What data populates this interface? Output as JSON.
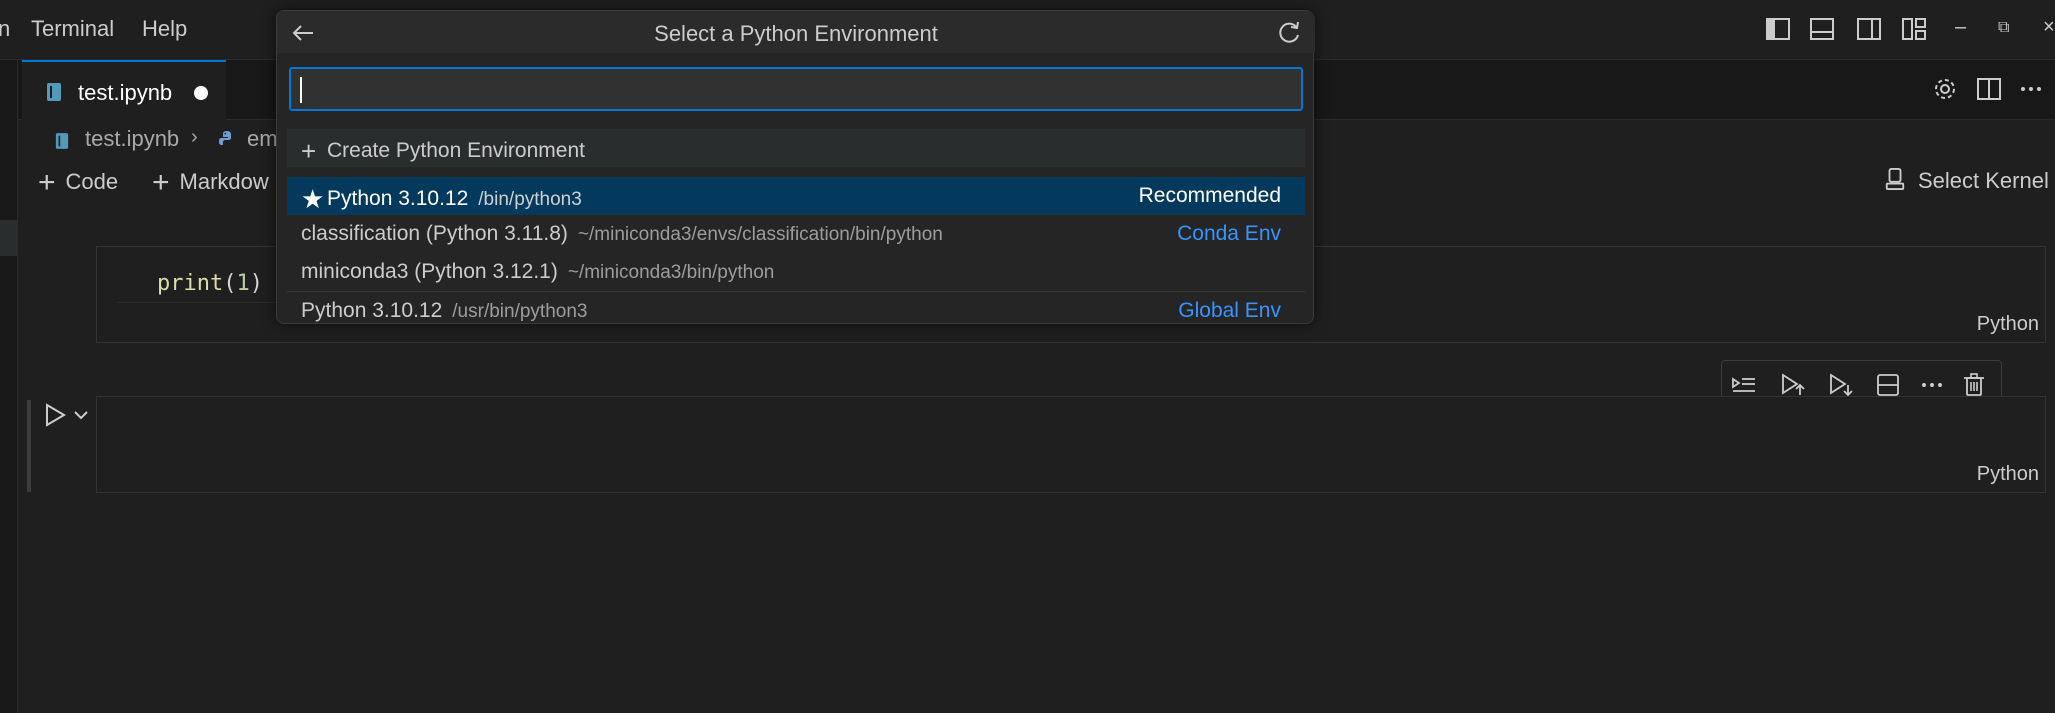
{
  "menu": {
    "partial_item": "n",
    "items": [
      "Terminal",
      "Help"
    ]
  },
  "editor": {
    "tab_label": "test.ipynb",
    "breadcrumb": [
      "test.ipynb",
      "em"
    ],
    "toolbar": {
      "code_label": "Code",
      "markdown_label": "Markdow",
      "select_kernel_label": "Select Kernel"
    },
    "cells": [
      {
        "code_fn": "print",
        "code_open": "(",
        "code_arg": "1",
        "code_close": ")",
        "language": "Python"
      },
      {
        "language": "Python"
      }
    ]
  },
  "quick_pick": {
    "title": "Select a Python Environment",
    "input_value": "",
    "items": [
      {
        "label": "Create Python Environment",
        "description": "",
        "detail": "",
        "icon": "plus-icon"
      },
      {
        "label": "Python 3.10.12",
        "description": "/bin/python3",
        "detail": "Recommended",
        "icon": "star-icon"
      },
      {
        "label": "classification (Python 3.11.8)",
        "description": "~/miniconda3/envs/classification/bin/python",
        "detail": "Conda Env"
      },
      {
        "label": "miniconda3 (Python 3.12.1)",
        "description": "~/miniconda3/bin/python",
        "detail": ""
      },
      {
        "label": "Python 3.10.12",
        "description": "/usr/bin/python3",
        "detail": "Global Env"
      }
    ]
  },
  "colors": {
    "accent": "#0078d4",
    "selection": "#04395e",
    "link": "#3794ff"
  }
}
